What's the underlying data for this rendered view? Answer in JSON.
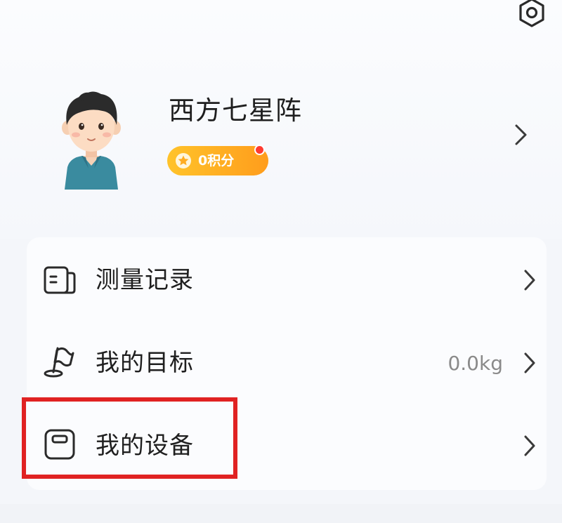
{
  "header": {
    "settings_icon": "settings-hexagon-icon"
  },
  "profile": {
    "username": "西方七星阵",
    "points_label": "0积分",
    "avatar": "cartoon-boy-avatar"
  },
  "menu": {
    "items": [
      {
        "label": "测量记录",
        "value": "",
        "icon": "document-list-icon"
      },
      {
        "label": "我的目标",
        "value": "0.0kg",
        "icon": "flag-target-icon"
      },
      {
        "label": "我的设备",
        "value": "",
        "icon": "scale-device-icon"
      }
    ]
  },
  "colors": {
    "badge_gradient_start": "#ffc32a",
    "badge_gradient_end": "#ff9d1c",
    "highlight_border": "#e02222",
    "notification_dot": "#ff3b30"
  }
}
